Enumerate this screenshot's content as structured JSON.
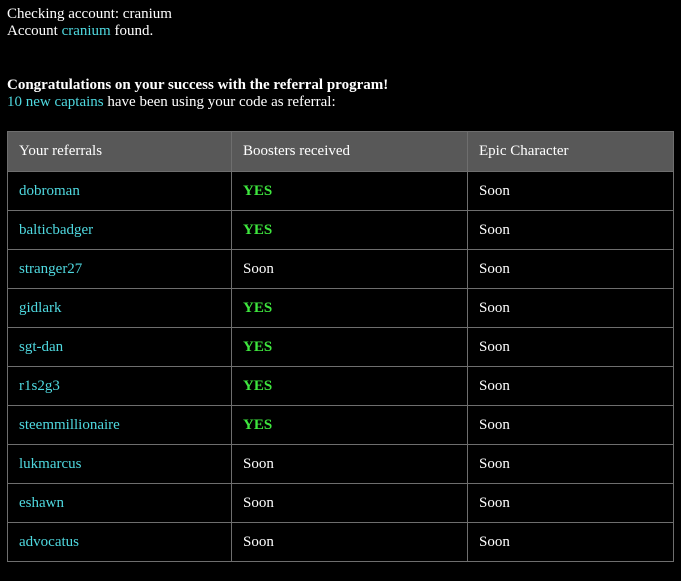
{
  "status": {
    "checking_label": "Checking account: cranium",
    "account_prefix": "Account",
    "account_name": "cranium",
    "account_suffix": "found."
  },
  "message": {
    "headline": "Congratulations on your success with the referral program!",
    "count_text": "10 new captains",
    "count_suffix": "have been using your code as referral:"
  },
  "table": {
    "headers": [
      "Your referrals",
      "Boosters received",
      "Epic Character"
    ],
    "rows": [
      {
        "name": "dobroman",
        "boosters": "YES",
        "epic": "Soon"
      },
      {
        "name": "balticbadger",
        "boosters": "YES",
        "epic": "Soon"
      },
      {
        "name": "stranger27",
        "boosters": "Soon",
        "epic": "Soon"
      },
      {
        "name": "gidlark",
        "boosters": "YES",
        "epic": "Soon"
      },
      {
        "name": "sgt-dan",
        "boosters": "YES",
        "epic": "Soon"
      },
      {
        "name": "r1s2g3",
        "boosters": "YES",
        "epic": "Soon"
      },
      {
        "name": "steemmillionaire",
        "boosters": "YES",
        "epic": "Soon"
      },
      {
        "name": "lukmarcus",
        "boosters": "Soon",
        "epic": "Soon"
      },
      {
        "name": "eshawn",
        "boosters": "Soon",
        "epic": "Soon"
      },
      {
        "name": "advocatus",
        "boosters": "Soon",
        "epic": "Soon"
      }
    ]
  },
  "colors": {
    "background": "#000000",
    "text": "#ffffff",
    "link": "#4fd9e0",
    "yes": "#3ee63e",
    "header_bg": "#585858",
    "border": "#6e6e6e"
  }
}
